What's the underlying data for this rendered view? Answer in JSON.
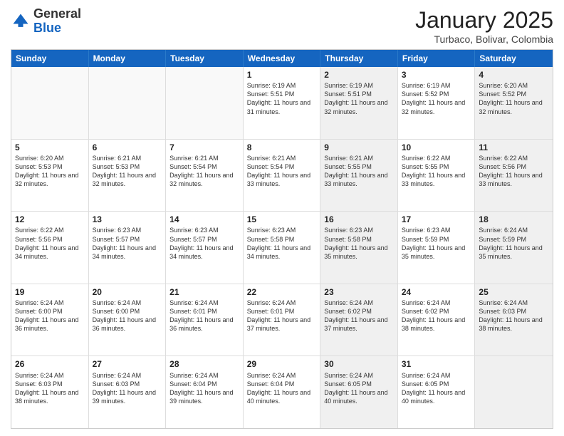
{
  "header": {
    "logo_general": "General",
    "logo_blue": "Blue",
    "month_title": "January 2025",
    "location": "Turbaco, Bolivar, Colombia"
  },
  "days_of_week": [
    "Sunday",
    "Monday",
    "Tuesday",
    "Wednesday",
    "Thursday",
    "Friday",
    "Saturday"
  ],
  "rows": [
    [
      {
        "day": "",
        "info": "",
        "shaded": false,
        "empty": true
      },
      {
        "day": "",
        "info": "",
        "shaded": false,
        "empty": true
      },
      {
        "day": "",
        "info": "",
        "shaded": false,
        "empty": true
      },
      {
        "day": "1",
        "info": "Sunrise: 6:19 AM\nSunset: 5:51 PM\nDaylight: 11 hours and 31 minutes.",
        "shaded": false,
        "empty": false
      },
      {
        "day": "2",
        "info": "Sunrise: 6:19 AM\nSunset: 5:51 PM\nDaylight: 11 hours and 32 minutes.",
        "shaded": true,
        "empty": false
      },
      {
        "day": "3",
        "info": "Sunrise: 6:19 AM\nSunset: 5:52 PM\nDaylight: 11 hours and 32 minutes.",
        "shaded": false,
        "empty": false
      },
      {
        "day": "4",
        "info": "Sunrise: 6:20 AM\nSunset: 5:52 PM\nDaylight: 11 hours and 32 minutes.",
        "shaded": true,
        "empty": false
      }
    ],
    [
      {
        "day": "5",
        "info": "Sunrise: 6:20 AM\nSunset: 5:53 PM\nDaylight: 11 hours and 32 minutes.",
        "shaded": false,
        "empty": false
      },
      {
        "day": "6",
        "info": "Sunrise: 6:21 AM\nSunset: 5:53 PM\nDaylight: 11 hours and 32 minutes.",
        "shaded": false,
        "empty": false
      },
      {
        "day": "7",
        "info": "Sunrise: 6:21 AM\nSunset: 5:54 PM\nDaylight: 11 hours and 32 minutes.",
        "shaded": false,
        "empty": false
      },
      {
        "day": "8",
        "info": "Sunrise: 6:21 AM\nSunset: 5:54 PM\nDaylight: 11 hours and 33 minutes.",
        "shaded": false,
        "empty": false
      },
      {
        "day": "9",
        "info": "Sunrise: 6:21 AM\nSunset: 5:55 PM\nDaylight: 11 hours and 33 minutes.",
        "shaded": true,
        "empty": false
      },
      {
        "day": "10",
        "info": "Sunrise: 6:22 AM\nSunset: 5:55 PM\nDaylight: 11 hours and 33 minutes.",
        "shaded": false,
        "empty": false
      },
      {
        "day": "11",
        "info": "Sunrise: 6:22 AM\nSunset: 5:56 PM\nDaylight: 11 hours and 33 minutes.",
        "shaded": true,
        "empty": false
      }
    ],
    [
      {
        "day": "12",
        "info": "Sunrise: 6:22 AM\nSunset: 5:56 PM\nDaylight: 11 hours and 34 minutes.",
        "shaded": false,
        "empty": false
      },
      {
        "day": "13",
        "info": "Sunrise: 6:23 AM\nSunset: 5:57 PM\nDaylight: 11 hours and 34 minutes.",
        "shaded": false,
        "empty": false
      },
      {
        "day": "14",
        "info": "Sunrise: 6:23 AM\nSunset: 5:57 PM\nDaylight: 11 hours and 34 minutes.",
        "shaded": false,
        "empty": false
      },
      {
        "day": "15",
        "info": "Sunrise: 6:23 AM\nSunset: 5:58 PM\nDaylight: 11 hours and 34 minutes.",
        "shaded": false,
        "empty": false
      },
      {
        "day": "16",
        "info": "Sunrise: 6:23 AM\nSunset: 5:58 PM\nDaylight: 11 hours and 35 minutes.",
        "shaded": true,
        "empty": false
      },
      {
        "day": "17",
        "info": "Sunrise: 6:23 AM\nSunset: 5:59 PM\nDaylight: 11 hours and 35 minutes.",
        "shaded": false,
        "empty": false
      },
      {
        "day": "18",
        "info": "Sunrise: 6:24 AM\nSunset: 5:59 PM\nDaylight: 11 hours and 35 minutes.",
        "shaded": true,
        "empty": false
      }
    ],
    [
      {
        "day": "19",
        "info": "Sunrise: 6:24 AM\nSunset: 6:00 PM\nDaylight: 11 hours and 36 minutes.",
        "shaded": false,
        "empty": false
      },
      {
        "day": "20",
        "info": "Sunrise: 6:24 AM\nSunset: 6:00 PM\nDaylight: 11 hours and 36 minutes.",
        "shaded": false,
        "empty": false
      },
      {
        "day": "21",
        "info": "Sunrise: 6:24 AM\nSunset: 6:01 PM\nDaylight: 11 hours and 36 minutes.",
        "shaded": false,
        "empty": false
      },
      {
        "day": "22",
        "info": "Sunrise: 6:24 AM\nSunset: 6:01 PM\nDaylight: 11 hours and 37 minutes.",
        "shaded": false,
        "empty": false
      },
      {
        "day": "23",
        "info": "Sunrise: 6:24 AM\nSunset: 6:02 PM\nDaylight: 11 hours and 37 minutes.",
        "shaded": true,
        "empty": false
      },
      {
        "day": "24",
        "info": "Sunrise: 6:24 AM\nSunset: 6:02 PM\nDaylight: 11 hours and 38 minutes.",
        "shaded": false,
        "empty": false
      },
      {
        "day": "25",
        "info": "Sunrise: 6:24 AM\nSunset: 6:03 PM\nDaylight: 11 hours and 38 minutes.",
        "shaded": true,
        "empty": false
      }
    ],
    [
      {
        "day": "26",
        "info": "Sunrise: 6:24 AM\nSunset: 6:03 PM\nDaylight: 11 hours and 38 minutes.",
        "shaded": false,
        "empty": false
      },
      {
        "day": "27",
        "info": "Sunrise: 6:24 AM\nSunset: 6:03 PM\nDaylight: 11 hours and 39 minutes.",
        "shaded": false,
        "empty": false
      },
      {
        "day": "28",
        "info": "Sunrise: 6:24 AM\nSunset: 6:04 PM\nDaylight: 11 hours and 39 minutes.",
        "shaded": false,
        "empty": false
      },
      {
        "day": "29",
        "info": "Sunrise: 6:24 AM\nSunset: 6:04 PM\nDaylight: 11 hours and 40 minutes.",
        "shaded": false,
        "empty": false
      },
      {
        "day": "30",
        "info": "Sunrise: 6:24 AM\nSunset: 6:05 PM\nDaylight: 11 hours and 40 minutes.",
        "shaded": true,
        "empty": false
      },
      {
        "day": "31",
        "info": "Sunrise: 6:24 AM\nSunset: 6:05 PM\nDaylight: 11 hours and 40 minutes.",
        "shaded": false,
        "empty": false
      },
      {
        "day": "",
        "info": "",
        "shaded": true,
        "empty": true
      }
    ]
  ]
}
